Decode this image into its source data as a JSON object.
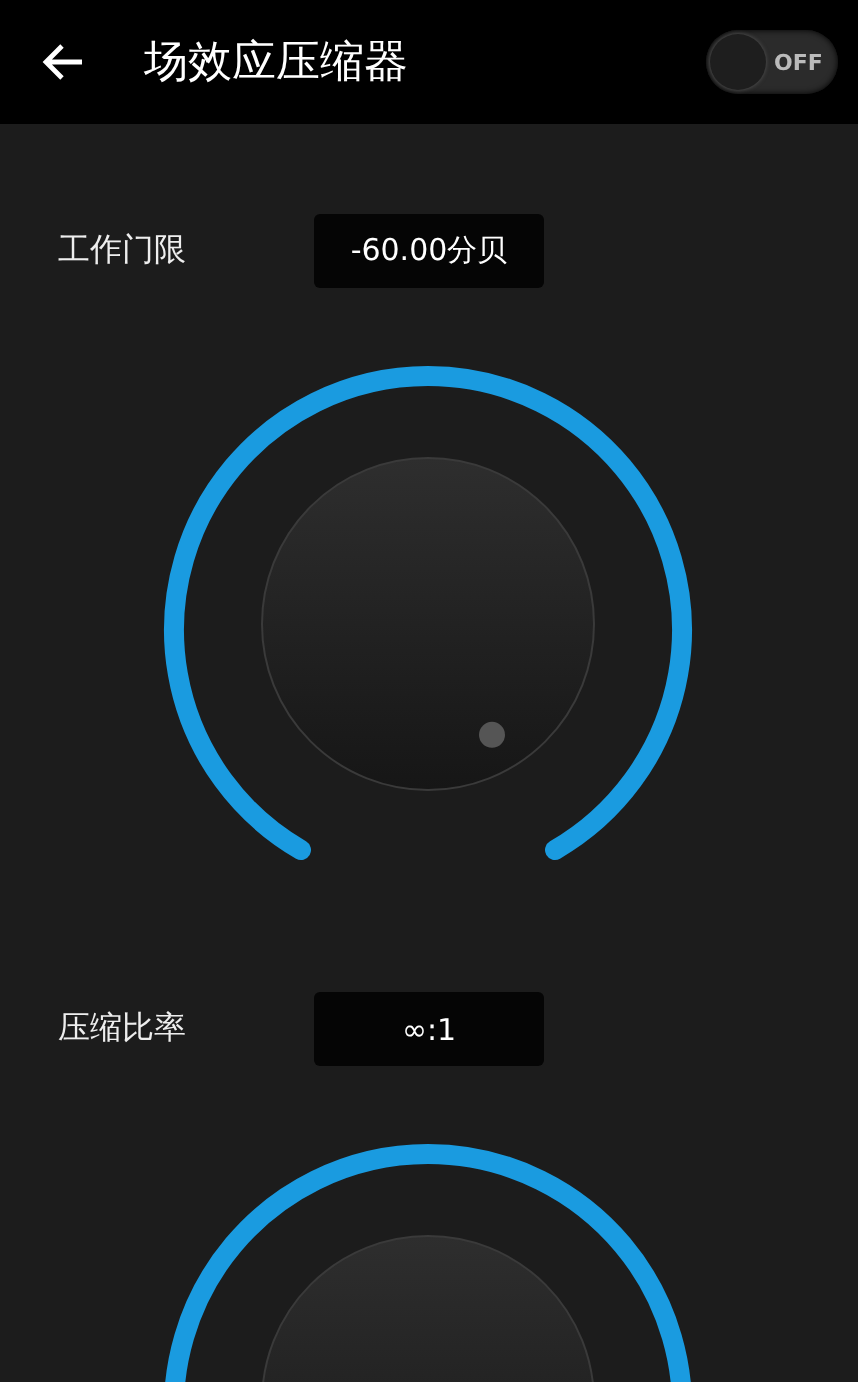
{
  "header": {
    "title": "场效应压缩器",
    "toggle": {
      "label": "OFF",
      "on": false
    }
  },
  "controls": [
    {
      "label": "工作门限",
      "value": "-60.00分贝"
    },
    {
      "label": "压缩比率",
      "value": "∞:1"
    }
  ]
}
